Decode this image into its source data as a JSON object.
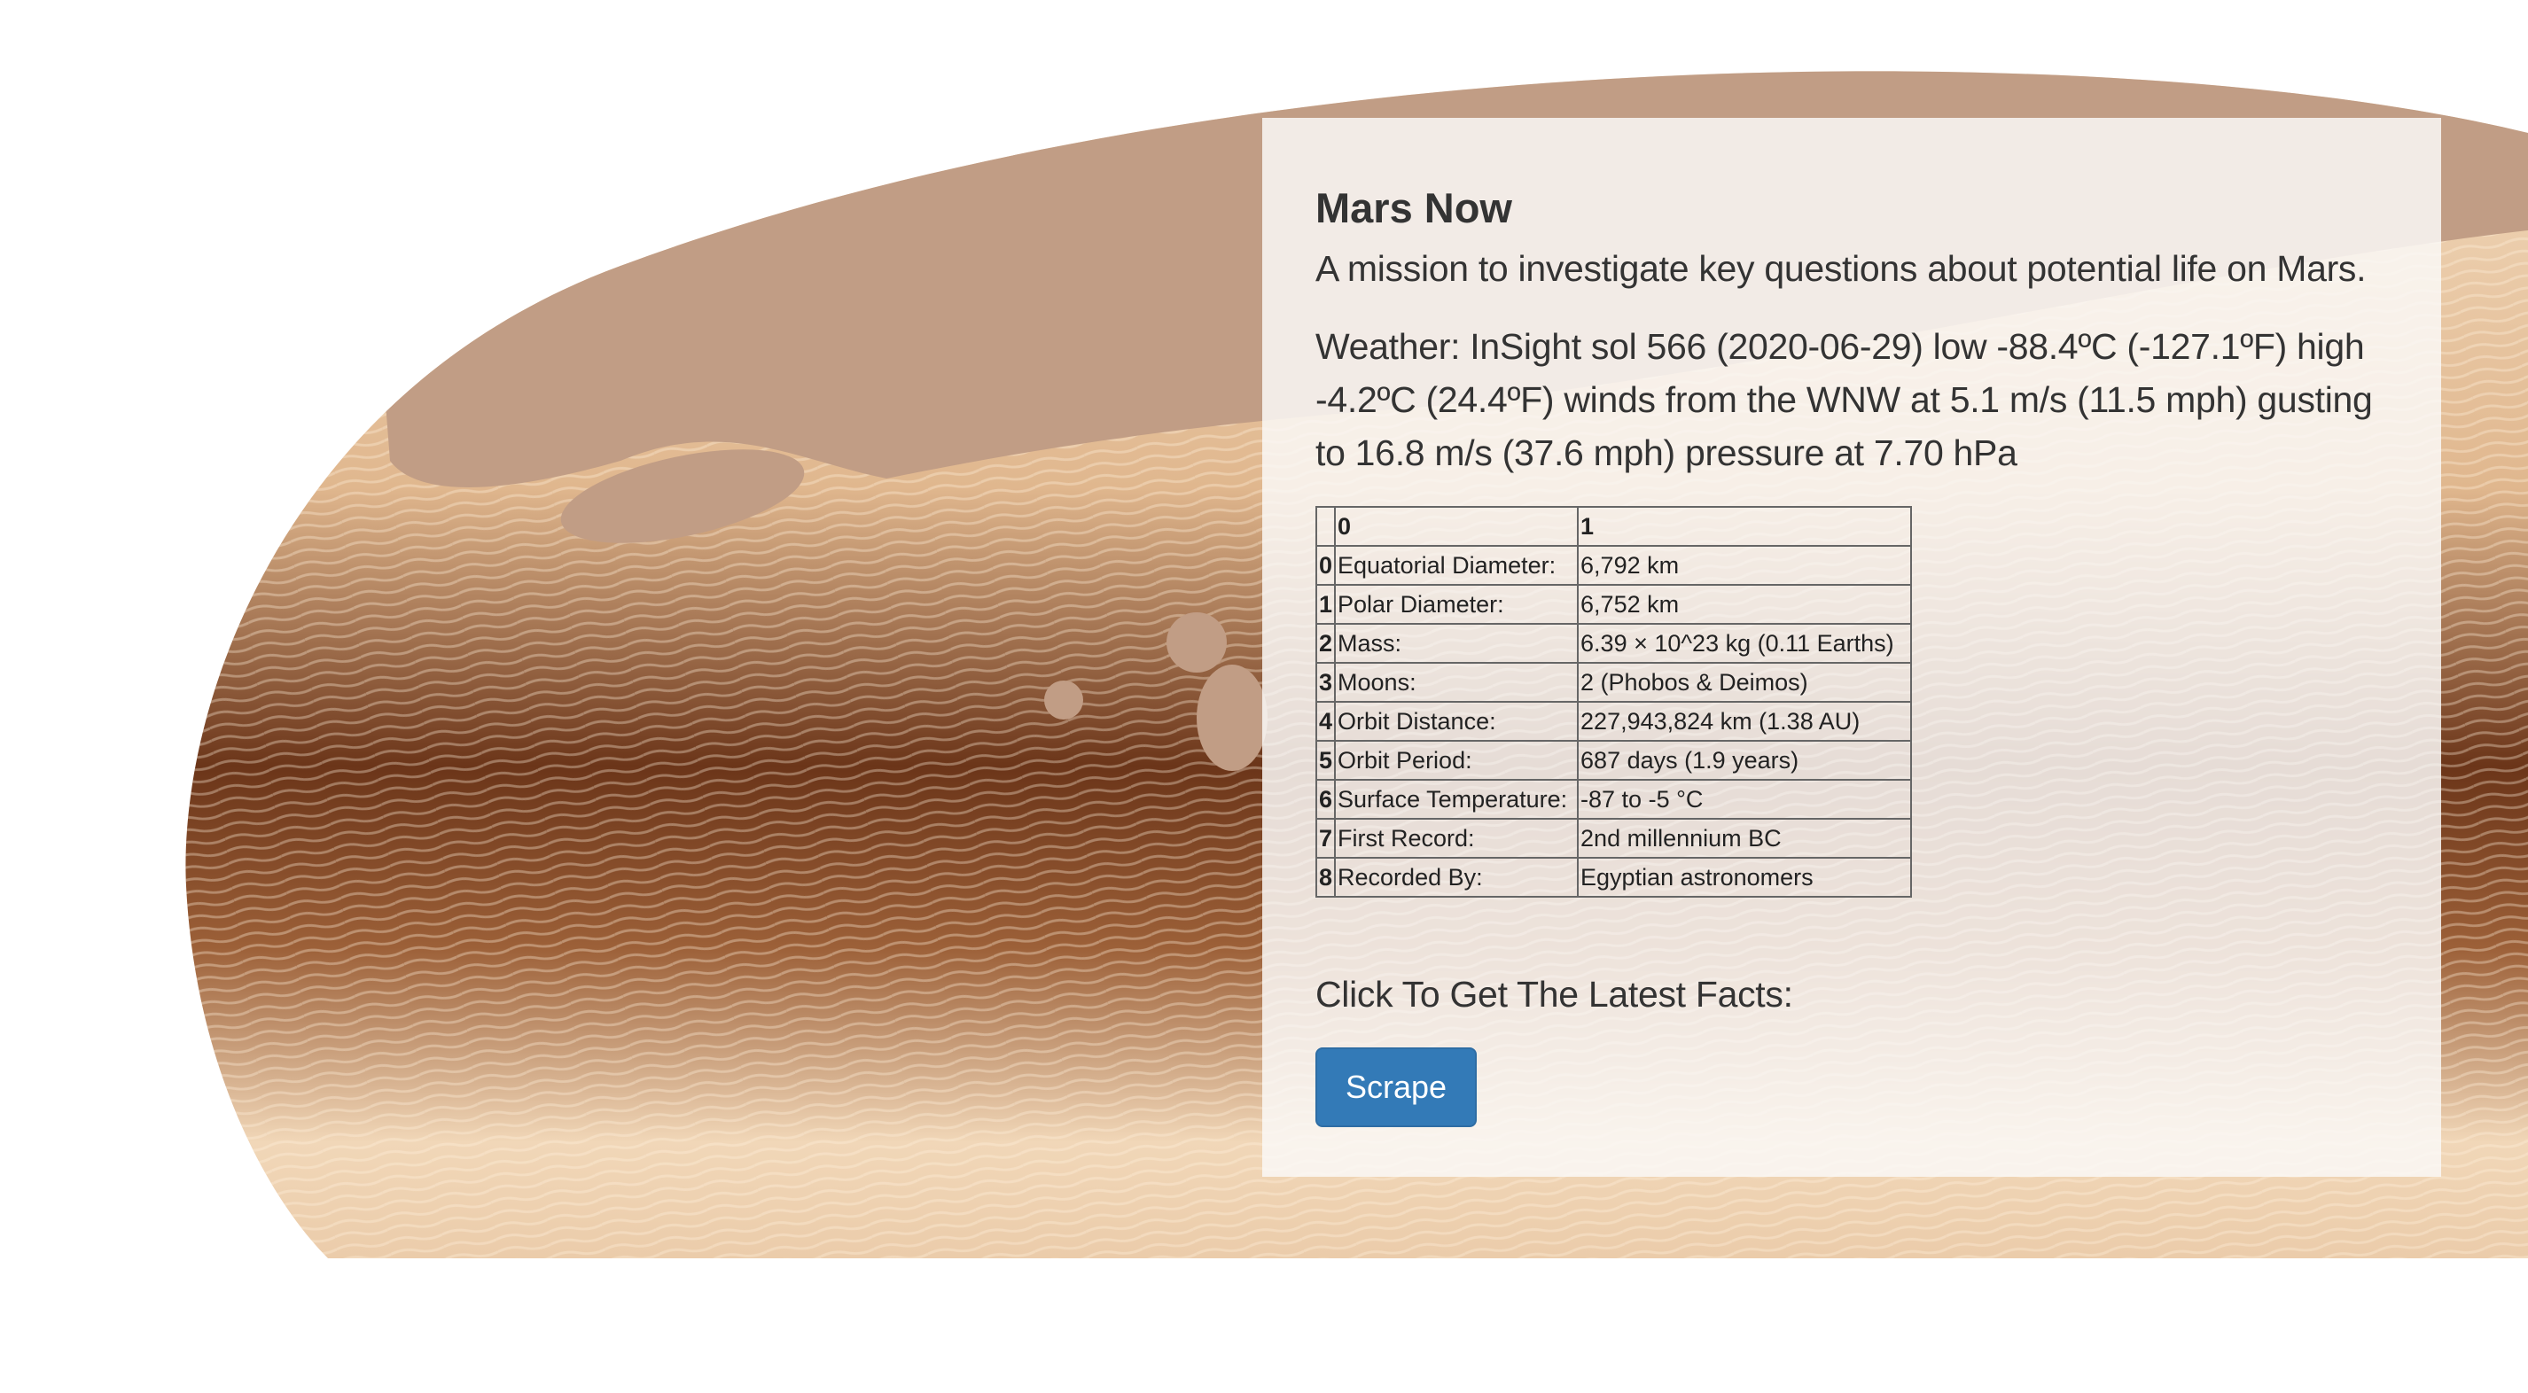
{
  "header": {
    "title": "Mars Now",
    "subtitle": "A mission to investigate key questions about potential life on Mars."
  },
  "weather": {
    "text": "Weather: InSight sol 566 (2020-06-29) low -88.4ºC (-127.1ºF) high -4.2ºC (24.4ºF) winds from the WNW at 5.1 m/s (11.5 mph) gusting to 16.8 m/s (37.6 mph) pressure at 7.70 hPa"
  },
  "facts_table": {
    "headers": [
      "",
      "0",
      "1"
    ],
    "rows": [
      {
        "index": "0",
        "label": "Equatorial Diameter:",
        "value": "6,792 km"
      },
      {
        "index": "1",
        "label": "Polar Diameter:",
        "value": "6,752 km"
      },
      {
        "index": "2",
        "label": "Mass:",
        "value": "6.39 × 10^23 kg (0.11 Earths)"
      },
      {
        "index": "3",
        "label": "Moons:",
        "value": "2 (Phobos & Deimos)"
      },
      {
        "index": "4",
        "label": "Orbit Distance:",
        "value": "227,943,824 km (1.38 AU)"
      },
      {
        "index": "5",
        "label": "Orbit Period:",
        "value": "687 days (1.9 years)"
      },
      {
        "index": "6",
        "label": "Surface Temperature:",
        "value": "-87 to -5 °C"
      },
      {
        "index": "7",
        "label": "First Record:",
        "value": "2nd millennium BC"
      },
      {
        "index": "8",
        "label": "Recorded By:",
        "value": "Egyptian astronomers"
      }
    ]
  },
  "cta": {
    "label": "Click To Get The Latest Facts:",
    "button_label": "Scrape"
  },
  "colors": {
    "accent": "#337ab7",
    "mars_light": "#f3dcc0",
    "mars_dark": "#5e2e14",
    "mars_mid": "#c49a7e"
  }
}
